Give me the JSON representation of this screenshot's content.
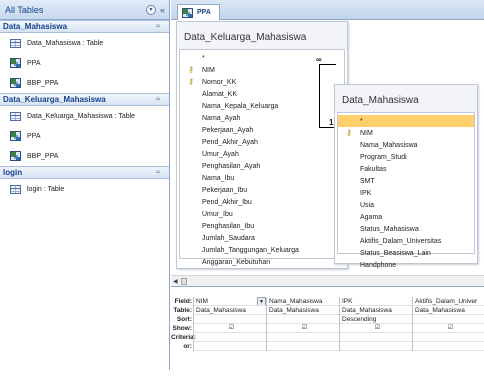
{
  "nav": {
    "header": "All Tables",
    "groups": [
      {
        "title": "Data_Mahasiswa",
        "items": [
          {
            "label": "Data_Mahasiswa : Table",
            "icon": "table-icon"
          },
          {
            "label": "PPA",
            "icon": "query-icon"
          },
          {
            "label": "BBP_PPA",
            "icon": "query-icon"
          }
        ]
      },
      {
        "title": "Data_Keluarga_Mahasiswa",
        "items": [
          {
            "label": "Data_Keluarga_Mahasiswa : Table",
            "icon": "table-icon"
          },
          {
            "label": "PPA",
            "icon": "query-icon"
          },
          {
            "label": "BBP_PPA",
            "icon": "query-icon"
          }
        ]
      },
      {
        "title": "login",
        "items": [
          {
            "label": "login : Table",
            "icon": "table-icon"
          }
        ]
      }
    ]
  },
  "tab": {
    "label": "PPA"
  },
  "tables": {
    "keluarga": {
      "title": "Data_Keluarga_Mahasiswa",
      "fields": [
        "*",
        "NIM",
        "Nomor_KK",
        "Alamat_KK",
        "Nama_Kepala_Keluarga",
        "Nama_Ayah",
        "Pekerjaan_Ayah",
        "Pend_Akhir_Ayah",
        "Umur_Ayah",
        "Penghasilan_Ayah",
        "Nama_Ibu",
        "Pekerjaan_Ibu",
        "Pend_Akhir_Ibu",
        "Umur_Ibu",
        "Penghasilan_Ibu",
        "Jumlah_Saudara",
        "Jumlah_Tanggungan_Keluarga",
        "Anggaran_Kebutuhan"
      ]
    },
    "mahasiswa": {
      "title": "Data_Mahasiswa",
      "fields": [
        "*",
        "NIM",
        "Nama_Mahasiswa",
        "Program_Studi",
        "Fakultas",
        "SMT",
        "IPK",
        "Usia",
        "Agama",
        "Status_Mahasiswa",
        "Aktifis_Dalam_Universitas",
        "Status_Beasiswa_Lain",
        "Handphone"
      ]
    }
  },
  "relationship": {
    "many": "∞",
    "one": "1"
  },
  "grid": {
    "row_labels": [
      "Field:",
      "Table:",
      "Sort:",
      "Show:",
      "Criteria:",
      "or:"
    ],
    "columns": [
      {
        "field": "NIM",
        "table": "Data_Mahasiswa",
        "sort": "",
        "show": "☑"
      },
      {
        "field": "Nama_Mahasiswa",
        "table": "Data_Mahasiswa",
        "sort": "",
        "show": "☑"
      },
      {
        "field": "IPK",
        "table": "Data_Mahasiswa",
        "sort": "Descending",
        "show": "☑"
      },
      {
        "field": "Aktifis_Dalam_Univer",
        "table": "Data_Mahasiswa",
        "sort": "",
        "show": "☑"
      }
    ]
  },
  "icons": {
    "nav_header_menu": "chevron-down-icon",
    "nav_collapse": "double-chevron-left-icon",
    "group_collapse": "double-chevron-up-icon"
  }
}
